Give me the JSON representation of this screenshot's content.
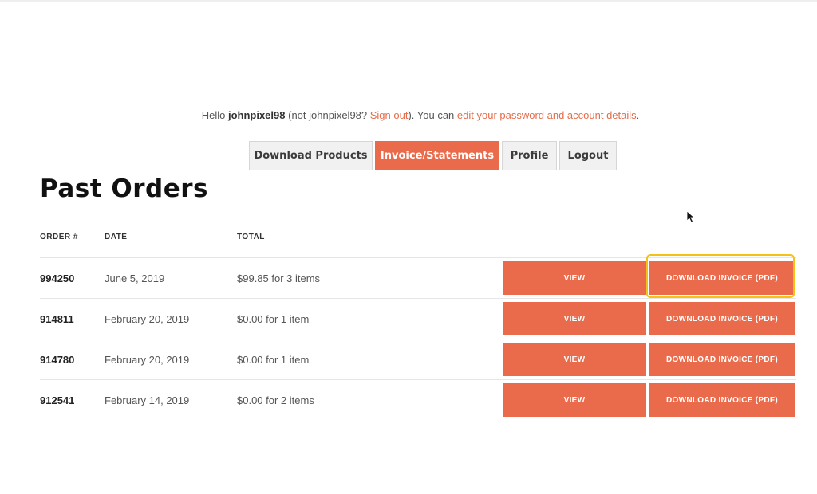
{
  "account": {
    "greeting_prefix": "Hello ",
    "username": "johnpixel98",
    "not_prefix": " (not johnpixel98? ",
    "sign_out": "Sign out",
    "middle": "). You can ",
    "edit_link": "edit your password and account details",
    "suffix": "."
  },
  "tabs": [
    {
      "label": "Download Products",
      "active": false
    },
    {
      "label": "Invoice/Statements",
      "active": true
    },
    {
      "label": "Profile",
      "active": false
    },
    {
      "label": "Logout",
      "active": false
    }
  ],
  "page_title": "Past Orders",
  "table": {
    "columns": [
      "ORDER #",
      "DATE",
      "TOTAL"
    ],
    "rows": [
      {
        "order": "994250",
        "date": "June 5, 2019",
        "total": "$99.85 for 3 items",
        "view": "VIEW",
        "download": "DOWNLOAD INVOICE (PDF)"
      },
      {
        "order": "914811",
        "date": "February 20, 2019",
        "total": "$0.00 for 1 item",
        "view": "VIEW",
        "download": "DOWNLOAD INVOICE (PDF)"
      },
      {
        "order": "914780",
        "date": "February 20, 2019",
        "total": "$0.00 for 1 item",
        "view": "VIEW",
        "download": "DOWNLOAD INVOICE (PDF)"
      },
      {
        "order": "912541",
        "date": "February 14, 2019",
        "total": "$0.00 for 2 items",
        "view": "VIEW",
        "download": "DOWNLOAD INVOICE (PDF)"
      }
    ]
  },
  "colors": {
    "accent": "#e96b4b",
    "link": "#e56d4b",
    "highlight": "#f2c21b"
  },
  "icons": {
    "cursor": "mouse-pointer-icon"
  }
}
